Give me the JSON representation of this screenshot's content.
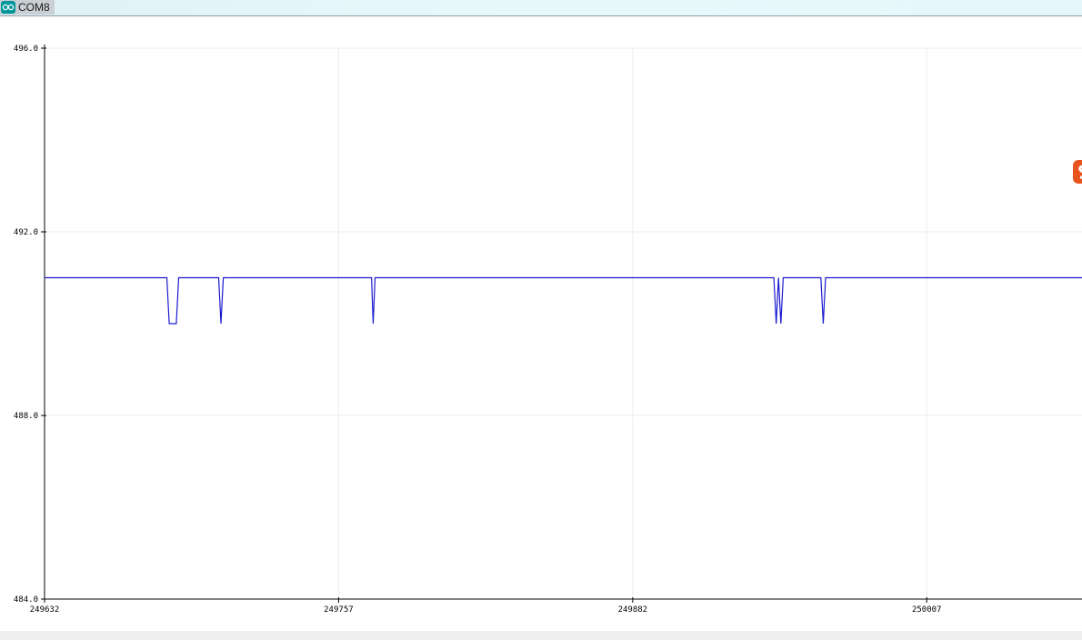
{
  "window": {
    "tab_title": "COM8",
    "tab_icon": "arduino-infinity-icon"
  },
  "overlay": {
    "badge_icon": "orange-s-badge-icon",
    "badge_color": "#e8541e"
  },
  "chart_data": {
    "type": "line",
    "title": "",
    "xlabel": "",
    "ylabel": "",
    "xlim": [
      249632,
      250073
    ],
    "ylim": [
      484.0,
      496.0
    ],
    "x_ticks": [
      "249632",
      "249757",
      "249882",
      "250007"
    ],
    "y_ticks": [
      "484.0",
      "488.0",
      "492.0",
      "496.0"
    ],
    "grid": true,
    "colors": {
      "line": "#1a1ad0",
      "grid": "#ececec",
      "axis": "#000000"
    },
    "series": [
      {
        "name": "",
        "points": [
          [
            249632,
            491
          ],
          [
            249684,
            491
          ],
          [
            249685,
            490
          ],
          [
            249688,
            490
          ],
          [
            249689,
            491
          ],
          [
            249706,
            491
          ],
          [
            249707,
            490
          ],
          [
            249708,
            491
          ],
          [
            249771,
            491
          ],
          [
            249771.7,
            490
          ],
          [
            249772.5,
            491
          ],
          [
            249942,
            491
          ],
          [
            249943,
            490
          ],
          [
            249944,
            491
          ],
          [
            249945,
            490
          ],
          [
            249946,
            491
          ],
          [
            249962,
            491
          ],
          [
            249963,
            490
          ],
          [
            249964,
            491
          ],
          [
            250073,
            491
          ]
        ]
      }
    ]
  }
}
